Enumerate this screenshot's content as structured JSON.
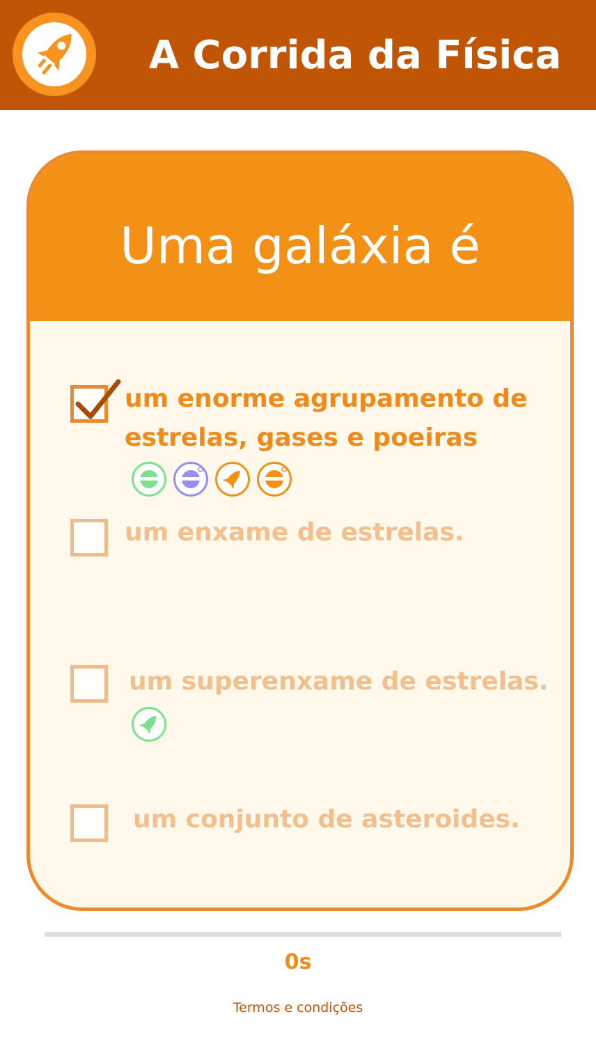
{
  "header": {
    "title": "A Corrida da Física",
    "logo_icon": "rocket-icon",
    "background": "#c05506"
  },
  "question": {
    "text": "Uma galáxia é"
  },
  "options": [
    {
      "label": "um enorme agrupamento de estrelas, gases e poeiras",
      "checked": true,
      "player_avatars": [
        "green-planet-icon",
        "purple-planet-icon",
        "orange-rocket-icon",
        "orange-planet-icon"
      ]
    },
    {
      "label": "um enxame de estrelas.",
      "checked": false,
      "player_avatars": []
    },
    {
      "label": "um superenxame de estrelas.",
      "checked": false,
      "player_avatars": [
        "green-rocket-icon"
      ]
    },
    {
      "label": "um conjunto de asteroides.",
      "checked": false,
      "player_avatars": []
    }
  ],
  "progress": {
    "fraction": 0
  },
  "timer": {
    "text": "0s"
  },
  "footer": {
    "terms_link": "Termos e condições"
  },
  "colors": {
    "accent": "#f39116",
    "dark_accent": "#c05506",
    "selected_text": "#ef8a1b",
    "unselected_text": "#f1c08e",
    "card_body": "#fff9ec",
    "avatar_green": "#7ee08e",
    "avatar_purple": "#9a8cf0",
    "avatar_orange": "#f39116"
  }
}
